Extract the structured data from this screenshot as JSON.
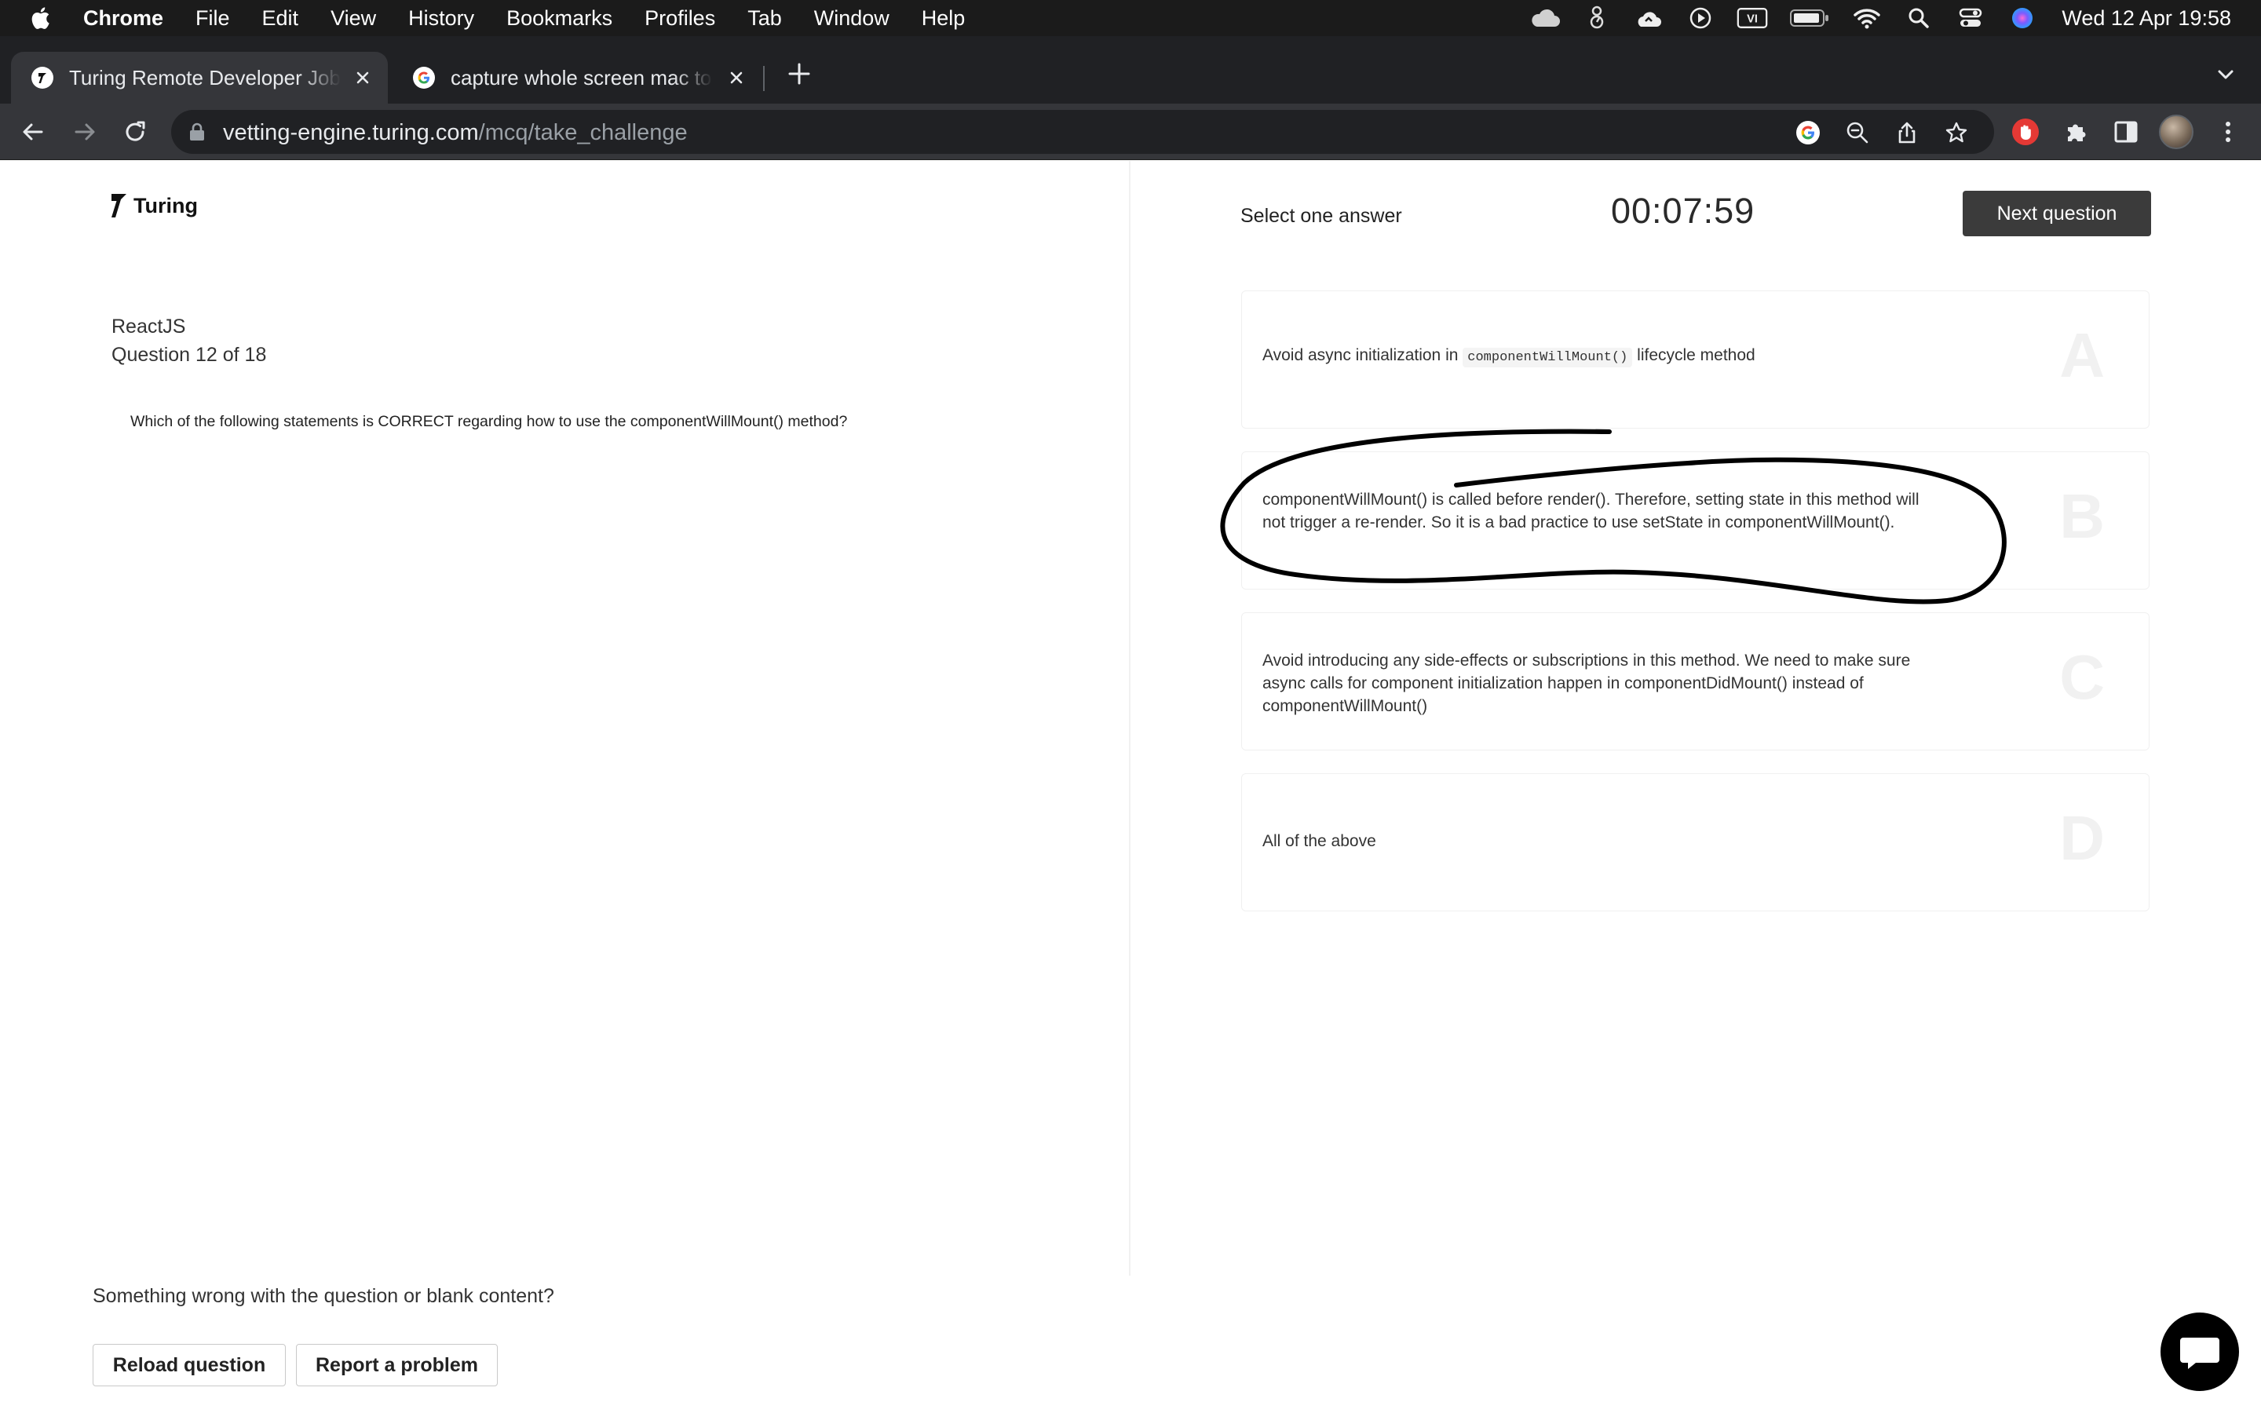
{
  "menubar": {
    "app_name": "Chrome",
    "items": [
      "File",
      "Edit",
      "View",
      "History",
      "Bookmarks",
      "Profiles",
      "Tab",
      "Window",
      "Help"
    ],
    "status_icons": [
      "cloud-icon",
      "gauge-icon",
      "cloud-sync-icon",
      "play-circle-icon",
      "vi-input-icon",
      "battery-icon",
      "wifi-icon",
      "spotlight-search-icon",
      "control-center-icon",
      "siri-icon"
    ],
    "vi_label": "VI",
    "clock": "Wed 12 Apr  19:58"
  },
  "tabs": [
    {
      "title": "Turing Remote Developer Jobs",
      "favicon": "turing-favicon",
      "active": true
    },
    {
      "title": "capture whole screen mac to file",
      "favicon": "google-favicon",
      "active": false
    }
  ],
  "omnibox": {
    "host": "vetting-engine.turing.com",
    "path": "/mcq/take_challenge"
  },
  "brand": {
    "name": "Turing"
  },
  "question": {
    "subject": "ReactJS",
    "count": "Question 12 of 18",
    "text": "Which of the following statements is CORRECT regarding how to use the componentWillMount() method?"
  },
  "answers": {
    "prompt": "Select one answer",
    "timer": "00:07:59",
    "next_label": "Next question",
    "options": [
      {
        "letter": "A",
        "before": "Avoid async initialization in ",
        "code": "componentWillMount()",
        "after": " lifecycle method"
      },
      {
        "letter": "B",
        "text": "componentWillMount() is called before render(). Therefore, setting state in this method will not trigger a re-render. So it is a bad practice to use setState in componentWillMount()."
      },
      {
        "letter": "C",
        "text": "Avoid introducing any side-effects or subscriptions in this method. We need to make sure async calls for component initialization happen in componentDidMount() instead of componentWillMount()"
      },
      {
        "letter": "D",
        "text": "All of the above"
      }
    ]
  },
  "footer": {
    "problem_text": "Something wrong with the question or blank content?",
    "reload_label": "Reload question",
    "report_label": "Report a problem"
  },
  "colors": {
    "menubar": "#1b1b1b",
    "tabstrip": "#202124",
    "toolbar": "#35363a",
    "next_button": "#3b3b3b",
    "annotation_ink": "#000000"
  }
}
